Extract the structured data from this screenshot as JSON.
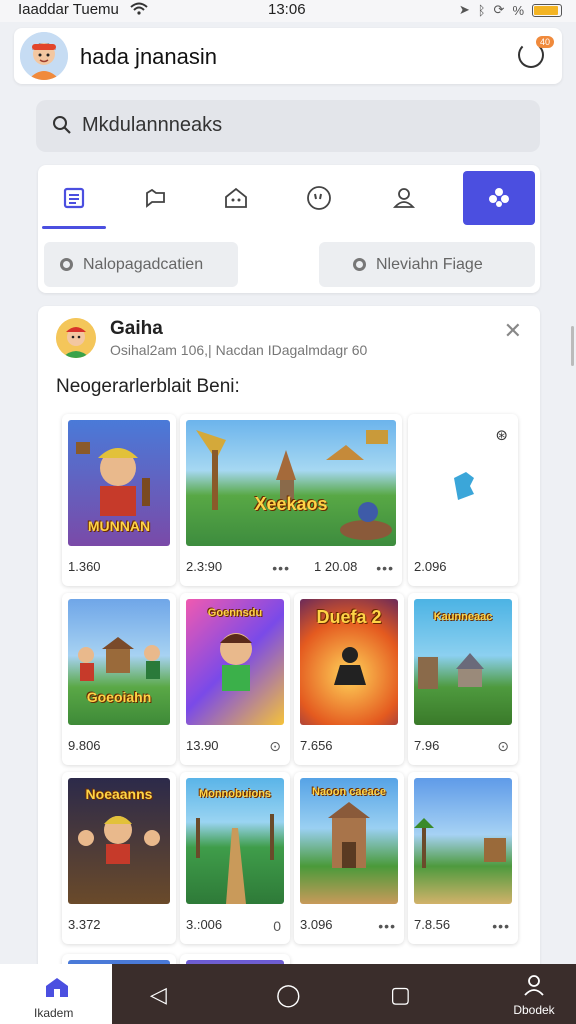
{
  "status_bar": {
    "carrier": "Iaaddаr Tuemu",
    "time": "13:06",
    "battery_level": 0.85,
    "battery_color": "#f3b423"
  },
  "header": {
    "title": "hada jnanasin",
    "badge": "40",
    "refresh_icon": "refresh-icon"
  },
  "search": {
    "placeholder": "Mkdulannneaks"
  },
  "tabs": [
    {
      "icon": "list-icon",
      "glyph": "☰",
      "active_underline": true
    },
    {
      "icon": "chat-icon",
      "glyph": "⌂"
    },
    {
      "icon": "shop-icon",
      "glyph": "⌂"
    },
    {
      "icon": "emoji-icon",
      "glyph": "☺"
    },
    {
      "icon": "person-icon",
      "glyph": "♟"
    },
    {
      "icon": "gamepad-icon",
      "glyph": "✱",
      "active": true
    }
  ],
  "chips": [
    {
      "label": "Nalopagadcatien"
    },
    {
      "label": "Nleviahn Fiage"
    }
  ],
  "post": {
    "author": "Gaiha",
    "meta": "Osihal2am 106,| Nacdan IDagalmdagr 60",
    "description": "Neogerarlerblait Beni:"
  },
  "games": [
    {
      "title": "MUNNAN",
      "num": "1.360",
      "num2": "",
      "bg": "#4a7ad8"
    },
    {
      "title": "Xeekaos",
      "num": "2.3:90",
      "num2": "1 20.08",
      "bg": "#3d8c3e"
    },
    {
      "title": "",
      "num": "2.096",
      "num2": "",
      "bg": "#ffffff"
    },
    {
      "title": "Goeoiahn",
      "num": "9.806",
      "num2": "",
      "bg": "#6fa6e8"
    },
    {
      "title": "Goennsdu",
      "num": "13.90",
      "num2": "",
      "bg": "#d855c0"
    },
    {
      "title": "Duefa 2",
      "num": "7.656",
      "num2": "",
      "bg": "#e45a1f"
    },
    {
      "title": "Kaunneaac",
      "num": "7.96",
      "num2": "",
      "bg": "#4cb3e4"
    },
    {
      "title": "Noeaanns",
      "num": "3.372",
      "num2": "",
      "bg": "#2c2a4a"
    },
    {
      "title": "Monnobuions",
      "num": "3.:006",
      "num2": "",
      "bg": "#3f9d4a"
    },
    {
      "title": "Naoon caeace",
      "num": "3.096",
      "num2": "",
      "bg": "#56a3e6"
    },
    {
      "title": "",
      "num": "7.8.56",
      "num2": "",
      "bg": "#5f9be8"
    }
  ],
  "bottom_nav": {
    "home_label": "Ikadem",
    "profile_label": "Dbodek"
  }
}
